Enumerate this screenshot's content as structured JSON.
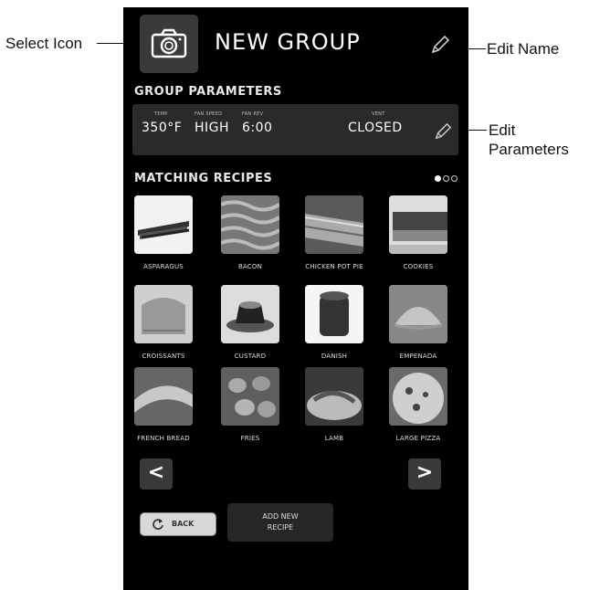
{
  "annotations": {
    "select_icon": "Select Icon",
    "edit_name": "Edit Name",
    "edit_parameters_line1": "Edit",
    "edit_parameters_line2": "Parameters"
  },
  "header": {
    "title": "NEW GROUP"
  },
  "group_parameters": {
    "heading": "GROUP PARAMETERS",
    "params": [
      {
        "label": "TEMP",
        "value": "350°F"
      },
      {
        "label": "FAN SPEED",
        "value": "HIGH"
      },
      {
        "label": "FAN REV",
        "value": "6:00"
      },
      {
        "label": "VENT",
        "value": "CLOSED"
      }
    ]
  },
  "matching_recipes": {
    "heading": "MATCHING RECIPES",
    "page_indicator": {
      "current": 1,
      "total": 3
    },
    "recipes": [
      {
        "name": "ASPARAGUS",
        "image": "asparagus"
      },
      {
        "name": "BACON",
        "image": "bacon"
      },
      {
        "name": "CHICKEN POT PIE",
        "image": "chicken-pot-pie"
      },
      {
        "name": "COOKIES",
        "image": "cookies"
      },
      {
        "name": "CROISSANTS",
        "image": "croissants"
      },
      {
        "name": "CUSTARD",
        "image": "custard"
      },
      {
        "name": "DANISH",
        "image": "danish"
      },
      {
        "name": "EMPENADA",
        "image": "empenada"
      },
      {
        "name": "FRENCH BREAD",
        "image": "french-bread"
      },
      {
        "name": "FRIES",
        "image": "fries"
      },
      {
        "name": "LAMB",
        "image": "lamb"
      },
      {
        "name": "LARGE PIZZA",
        "image": "large-pizza"
      }
    ]
  },
  "navigation": {
    "prev_label": "<",
    "next_label": ">"
  },
  "footer": {
    "back_label": "BACK",
    "add_new_recipe_line1": "ADD NEW",
    "add_new_recipe_line2": "RECIPE"
  },
  "icons": {
    "camera": "camera-icon",
    "edit": "pencil-icon",
    "back": "refresh-arrow-icon"
  }
}
